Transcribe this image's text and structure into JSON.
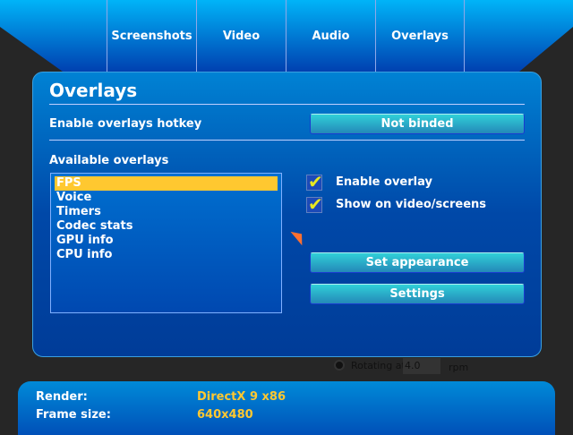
{
  "tabs": [
    "Screenshots",
    "Video",
    "Audio",
    "Overlays"
  ],
  "background": {
    "rotating_label": "Rotating at",
    "rotating_value": "4.0",
    "rpm": "rpm"
  },
  "panel": {
    "title": "Overlays",
    "hotkey_label": "Enable overlays hotkey",
    "hotkey_button": "Not binded",
    "available_label": "Available overlays",
    "overlays": [
      "FPS",
      "Voice",
      "Timers",
      "Codec stats",
      "GPU info",
      "CPU info"
    ],
    "selected": "FPS",
    "enable_overlay": "Enable overlay",
    "show_on_video": "Show on video/screens",
    "set_appearance": "Set appearance",
    "settings": "Settings"
  },
  "status": {
    "render_label": "Render:",
    "render_value": "DirectX 9 x86",
    "frame_label": "Frame size:",
    "frame_value": "640x480"
  }
}
